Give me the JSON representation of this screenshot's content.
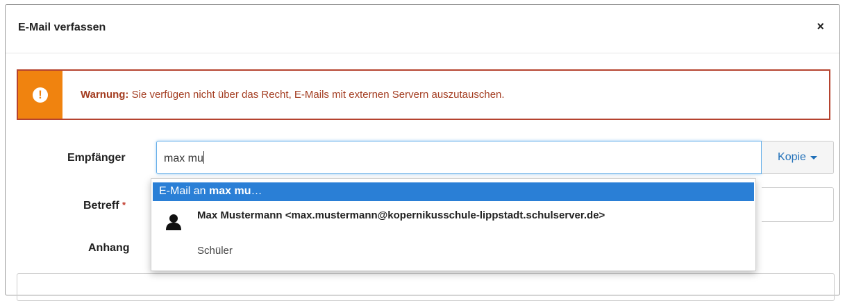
{
  "dialog": {
    "title": "E-Mail verfassen",
    "close_label": "×"
  },
  "alert": {
    "icon": "!",
    "strong": "Warnung:",
    "message": " Sie verfügen nicht über das Recht, E-Mails mit externen Servern auszutauschen."
  },
  "form": {
    "recipient_label": "Empfänger",
    "recipient_value": "max mu",
    "kopie_label": "Kopie",
    "subject_label": "Betreff",
    "required_mark": "*",
    "attachment_label": "Anhang"
  },
  "suggestions": {
    "email_prefix": "E-Mail an ",
    "email_query": "max mu",
    "email_suffix": "…",
    "contact_name": "Max Mustermann <max.mustermann@kopernikusschule-lippstadt.schulserver.de>",
    "contact_role": "Schüler"
  },
  "colors": {
    "alert_border": "#b5432f",
    "alert_icon_bg": "#f0830f",
    "highlight": "#2a7fd6",
    "link": "#1f6fb8"
  }
}
